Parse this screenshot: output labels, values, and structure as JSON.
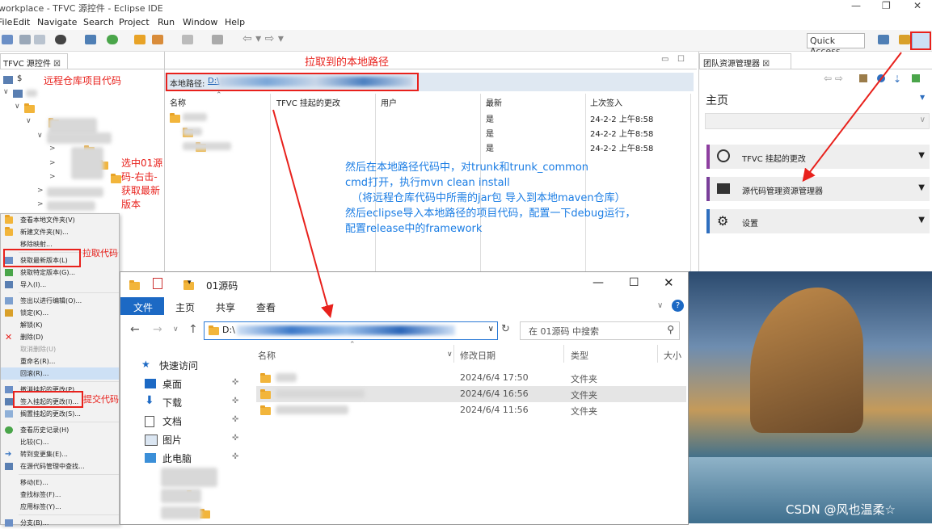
{
  "window": {
    "title": "workplace - TFVC 源控件 - Eclipse IDE"
  },
  "menubar": [
    "File",
    "Edit",
    "Navigate",
    "Search",
    "Project",
    "Run",
    "Window",
    "Help"
  ],
  "toolbar": {
    "quick_access": "Quick Access"
  },
  "left_panel": {
    "tab": "TFVC 源控件 ☒",
    "root_label": "$",
    "annotation_remote": "远程仓库项目代码",
    "annotation_select": "选中01源码-右击-获取最新版本"
  },
  "center_panel": {
    "annotation_local": "拉取到的本地路径",
    "local_path_label": "本地路径:",
    "local_path_value": "D:\\",
    "columns": [
      "名称",
      "TFVC 挂起的更改",
      "用户",
      "最新",
      "上次签入"
    ],
    "rows": [
      {
        "latest": "是",
        "checkin": "24-2-2 上午8:58"
      },
      {
        "latest": "是",
        "checkin": "24-2-2 上午8:58"
      },
      {
        "latest": "是",
        "checkin": "24-2-2 上午8:58"
      }
    ],
    "instructions": [
      "然后在本地路径代码中，对trunk和trunk_common",
      "cmd打开，执行mvn clean install",
      "（将远程仓库代码中所需的jar包 导入到本地maven仓库）",
      "然后eclipse导入本地路径的项目代码，配置一下debug运行，",
      "配置release中的framework"
    ]
  },
  "right_panel": {
    "tab": "团队资源管理器 ☒",
    "heading": "主页",
    "items": [
      {
        "label": "TFVC 挂起的更改",
        "color": "#8e3fa0"
      },
      {
        "label": "源代码管理资源管理器",
        "color": "#7a3f9a"
      },
      {
        "label": "设置",
        "color": "#2f6fbf"
      }
    ]
  },
  "context_menu": {
    "items": [
      "查看本地文件夹(V)",
      "新建文件夹(N)...",
      "移除映射...",
      "获取最新版本(L)",
      "获取特定版本(G)...",
      "导入(I)...",
      "签出以进行编辑(O)...",
      "锁定(K)...",
      "解锁(K)",
      "删除(D)",
      "取消删除(U)",
      "重命名(R)...",
      "回滚(R)...",
      "撤消挂起的更改(P)...",
      "签入挂起的更改(I)...",
      "搁置挂起的更改(S)...",
      "查看历史记录(H)",
      "比较(C)...",
      "转到变更集(E)...",
      "在源代码管理中查找...",
      "移动(E)...",
      "查找标签(F)...",
      "应用标签(Y)...",
      "分支(B)..."
    ],
    "annotation_pull": "拉取代码",
    "annotation_commit": "提交代码"
  },
  "explorer": {
    "title": "01源码",
    "ribbon_tabs": [
      "文件",
      "主页",
      "共享",
      "查看"
    ],
    "address": "D:\\",
    "search_placeholder": "在 01源码 中搜索",
    "nav": [
      "快速访问",
      "桌面",
      "下载",
      "文档",
      "图片",
      "此电脑"
    ],
    "columns": [
      "名称",
      "修改日期",
      "类型",
      "大小"
    ],
    "files": [
      {
        "date": "2024/6/4 17:50",
        "type": "文件夹"
      },
      {
        "date": "2024/6/4 16:56",
        "type": "文件夹"
      },
      {
        "date": "2024/6/4 11:56",
        "type": "文件夹"
      }
    ]
  },
  "watermark": "CSDN @风也温柔☆"
}
